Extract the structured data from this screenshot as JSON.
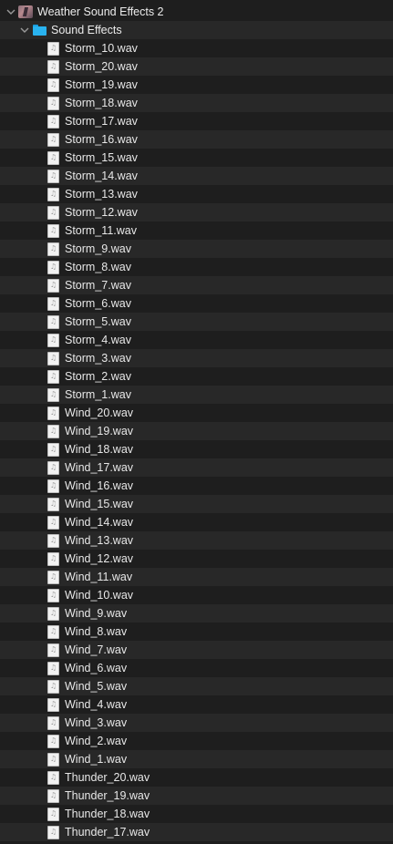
{
  "tree": {
    "root": {
      "label": "Weather Sound Effects 2",
      "icon": "project-thumbnail-icon",
      "expanded": true
    },
    "folder": {
      "label": "Sound Effects",
      "icon": "folder-icon",
      "icon_color": "#29b3f0",
      "expanded": true
    },
    "files": [
      "Storm_10.wav",
      "Storm_20.wav",
      "Storm_19.wav",
      "Storm_18.wav",
      "Storm_17.wav",
      "Storm_16.wav",
      "Storm_15.wav",
      "Storm_14.wav",
      "Storm_13.wav",
      "Storm_12.wav",
      "Storm_11.wav",
      "Storm_9.wav",
      "Storm_8.wav",
      "Storm_7.wav",
      "Storm_6.wav",
      "Storm_5.wav",
      "Storm_4.wav",
      "Storm_3.wav",
      "Storm_2.wav",
      "Storm_1.wav",
      "Wind_20.wav",
      "Wind_19.wav",
      "Wind_18.wav",
      "Wind_17.wav",
      "Wind_16.wav",
      "Wind_15.wav",
      "Wind_14.wav",
      "Wind_13.wav",
      "Wind_12.wav",
      "Wind_11.wav",
      "Wind_10.wav",
      "Wind_9.wav",
      "Wind_8.wav",
      "Wind_7.wav",
      "Wind_6.wav",
      "Wind_5.wav",
      "Wind_4.wav",
      "Wind_3.wav",
      "Wind_2.wav",
      "Wind_1.wav",
      "Thunder_20.wav",
      "Thunder_19.wav",
      "Thunder_18.wav",
      "Thunder_17.wav"
    ],
    "file_icon": "audio-file-icon"
  },
  "colors": {
    "background": "#1e1e1e",
    "alt_row": "#282828",
    "text": "#e8e8e8"
  }
}
